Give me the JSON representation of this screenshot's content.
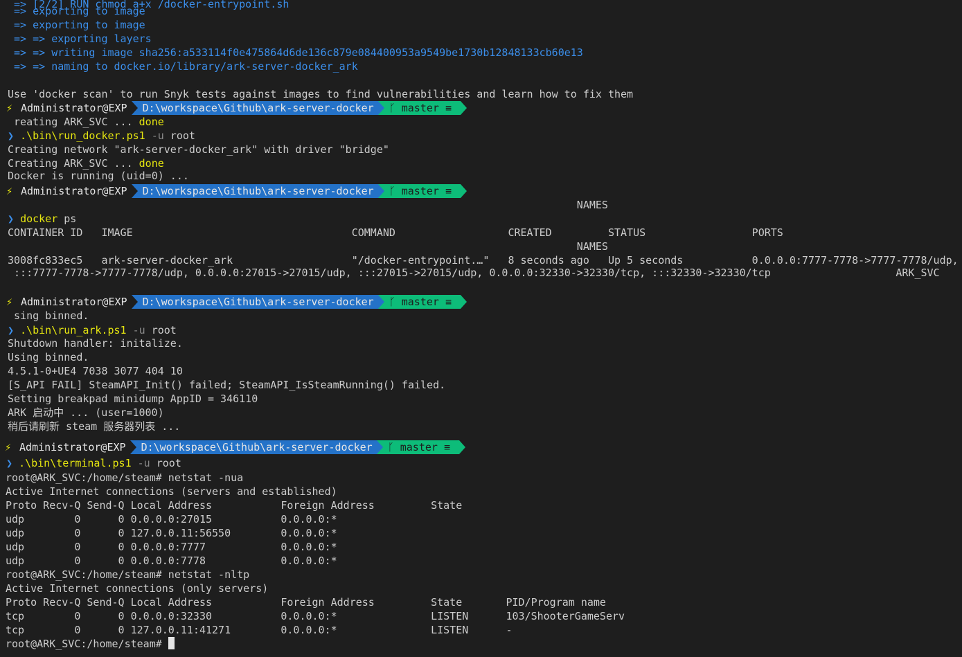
{
  "build_lines": [
    " => exporting to image",
    " => exporting to image",
    " => => exporting layers",
    " => => writing image sha256:a533114f0e475864d6de136c879e084400953a9549be1730b12848133cb60e13",
    " => => naming to docker.io/library/ark-server-docker_ark"
  ],
  "scan_hint": "Use 'docker scan' to run Snyk tests against images to find vulnerabilities and learn how to fix them",
  "prompt": {
    "host": "Administrator@EXP",
    "path": "D:\\workspace\\Github\\ark-server-docker",
    "branch": "master",
    "branch_icon": "git-branch-icon",
    "status_icon": "equiv-icon"
  },
  "block1": {
    "residue": " reating ARK_SVC ... ",
    "residue_status": "done",
    "command": ".\\bin\\run_docker.ps1",
    "args": " -u ",
    "arg_value": "root",
    "out1": "Creating network \"ark-server-docker_ark\" with driver \"bridge\"",
    "out2_prefix": "Creating ARK_SVC ... ",
    "out2_status": "done",
    "out3": "Docker is running (uid=0) ..."
  },
  "block2": {
    "residue": "                                                                                           NAMES",
    "command": "docker",
    "arg_value": "ps",
    "header": "CONTAINER ID   IMAGE                                   COMMAND                  CREATED         STATUS                 PORTS",
    "header2": "                                                                                           NAMES",
    "row1": "3008fc833ec5   ark-server-docker_ark                   \"/docker-entrypoint.…\"   8 seconds ago   Up 5 seconds           0.0.0.0:7777-7778->7777-7778/udp,",
    "row2": " :::7777-7778->7777-7778/udp, 0.0.0.0:27015->27015/udp, :::27015->27015/udp, 0.0.0.0:32330->32330/tcp, :::32330->32330/tcp                    ARK_SVC"
  },
  "block3": {
    "residue": " sing binned.",
    "command": ".\\bin\\run_ark.ps1",
    "args": " -u ",
    "arg_value": "root",
    "out": [
      "Shutdown handler: initalize.",
      "Using binned.",
      "4.5.1-0+UE4 7038 3077 404 10",
      "[S_API FAIL] SteamAPI_Init() failed; SteamAPI_IsSteamRunning() failed.",
      "Setting breakpad minidump AppID = 346110",
      "ARK 启动中 ... (user=1000)",
      "稍后请刷新 steam 服务器列表 ..."
    ]
  },
  "block4": {
    "command": ".\\bin\\terminal.ps1",
    "args": " -u ",
    "arg_value": "root",
    "out": [
      "root@ARK_SVC:/home/steam# netstat -nua",
      "Active Internet connections (servers and established)",
      "Proto Recv-Q Send-Q Local Address           Foreign Address         State",
      "udp        0      0 0.0.0.0:27015           0.0.0.0:*",
      "udp        0      0 127.0.0.11:56550        0.0.0.0:*",
      "udp        0      0 0.0.0.0:7777            0.0.0.0:*",
      "udp        0      0 0.0.0.0:7778            0.0.0.0:*",
      "root@ARK_SVC:/home/steam# netstat -nltp",
      "Active Internet connections (only servers)",
      "Proto Recv-Q Send-Q Local Address           Foreign Address         State       PID/Program name",
      "tcp        0      0 0.0.0.0:32330           0.0.0.0:*               LISTEN      103/ShooterGameServ",
      "tcp        0      0 127.0.0.11:41271        0.0.0.0:*               LISTEN      -"
    ],
    "final_prompt": "root@ARK_SVC:/home/steam# "
  },
  "colors": {
    "background": "#1e1e1e",
    "path_segment": "#2472c8",
    "git_segment": "#0dbc79",
    "build_text": "#3b8eea",
    "command_text": "#e5e510"
  }
}
